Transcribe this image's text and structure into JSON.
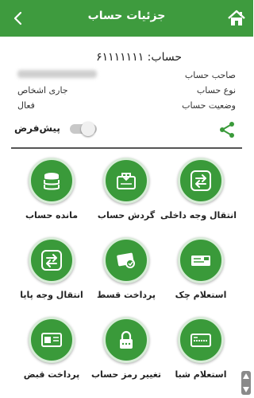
{
  "header": {
    "title": "جزئیات حساب",
    "bg_color": "#3e9b3e"
  },
  "account": {
    "number_label": "حساب: ۶۱۱۱۱۱۱۱",
    "owner_label": "صاحب حساب",
    "type_label": "نوع حساب",
    "type_value": "جاری اشخاص",
    "status_label": "وضعیت حساب",
    "status_value": "فعال"
  },
  "default_toggle": {
    "label": "پیش‌فرض",
    "state": "off"
  },
  "services": [
    {
      "label": "انتقال وجه داخلی",
      "icon": "transfer-icon"
    },
    {
      "label": "گردش حساب",
      "icon": "statement-icon"
    },
    {
      "label": "مانده حساب",
      "icon": "coins-icon"
    },
    {
      "label": "استعلام چک",
      "icon": "cheque-icon"
    },
    {
      "label": "پرداخت قسط",
      "icon": "installment-icon"
    },
    {
      "label": "انتقال وجه پایا",
      "icon": "paya-transfer-icon"
    },
    {
      "label": "استعلام شبا",
      "icon": "sheba-card-icon"
    },
    {
      "label": "تغییر رمز حساب",
      "icon": "lock-icon"
    },
    {
      "label": "پرداخت قبض",
      "icon": "bill-icon"
    }
  ],
  "colors": {
    "accent": "#3a9a3a",
    "divider": "#555555"
  }
}
